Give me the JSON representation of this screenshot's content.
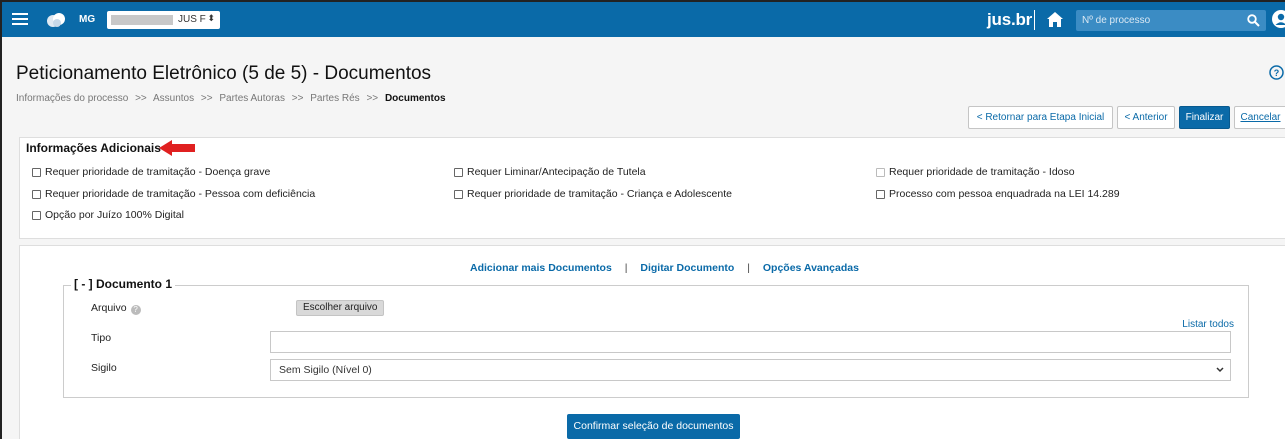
{
  "topbar": {
    "region": "MG",
    "orgao_suffix": "JUS F",
    "orgao_arrow": "⬍",
    "brand": "jus.br",
    "search_placeholder": "Nº de processo"
  },
  "header": {
    "title": "Peticionamento Eletrônico (5 de 5) - Documentos",
    "breadcrumb": {
      "items": [
        "Informações do processo",
        "Assuntos",
        "Partes Autoras",
        "Partes Rés"
      ],
      "separator": ">>",
      "current": "Documentos"
    }
  },
  "actions": {
    "return_initial": "< Retornar para Etapa Inicial",
    "previous": "< Anterior",
    "finish": "Finalizar",
    "cancel": "Cancelar"
  },
  "additional_info": {
    "title": "Informações Adicionais",
    "options": [
      "Requer prioridade de tramitação - Doença grave",
      "Requer Liminar/Antecipação de Tutela",
      "Requer prioridade de tramitação - Idoso",
      "Requer prioridade de tramitação - Pessoa com deficiência",
      "Requer prioridade de tramitação - Criança e Adolescente",
      "Processo com pessoa enquadrada na LEI 14.289",
      "Opção por Juízo 100% Digital"
    ]
  },
  "documents": {
    "links": {
      "add_more": "Adicionar mais Documentos",
      "type_document": "Digitar Documento",
      "advanced": "Opções Avançadas",
      "pipe": "|"
    },
    "document": {
      "legend": "[ - ] Documento 1",
      "file_label": "Arquivo",
      "file_button": "Escolher arquivo",
      "list_all": "Listar todos",
      "type_label": "Tipo",
      "type_value": "",
      "secrecy_label": "Sigilo",
      "secrecy_value": "Sem Sigilo (Nível 0)"
    },
    "confirm_button": "Confirmar seleção de documentos"
  },
  "colors": {
    "primary": "#0a6aa8",
    "arrow": "#e02020"
  }
}
